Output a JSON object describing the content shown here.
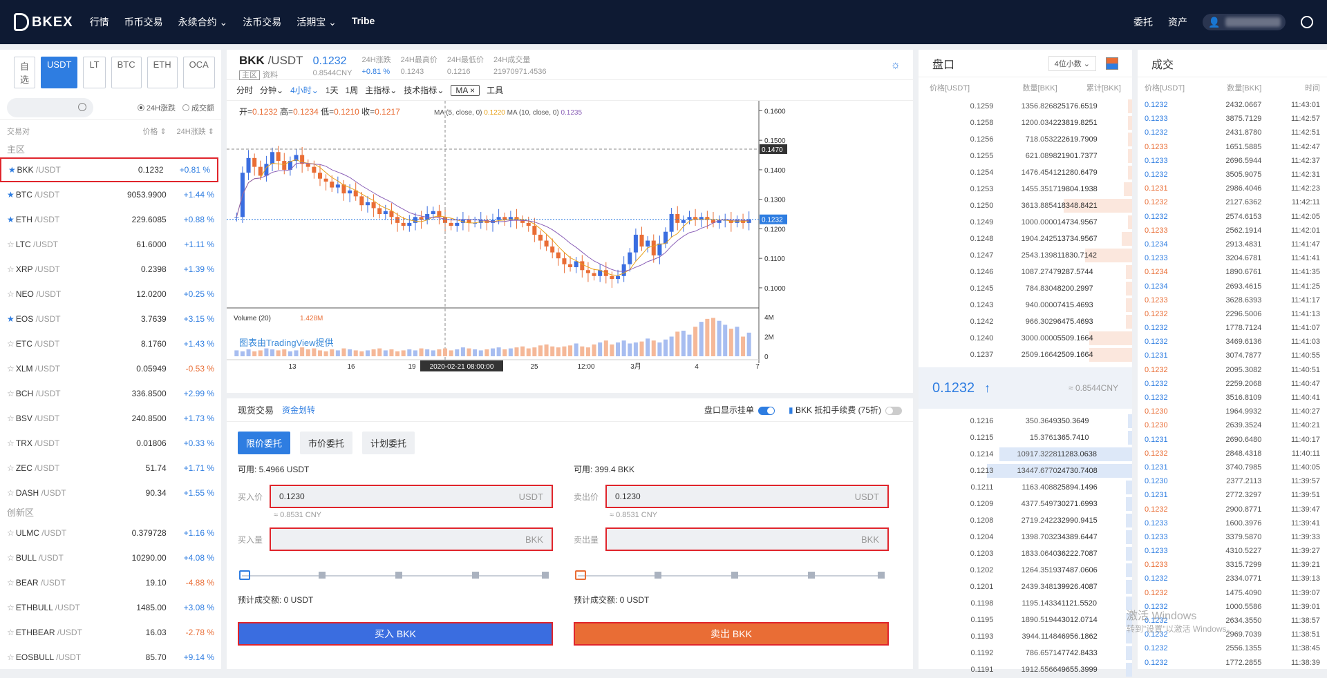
{
  "nav": {
    "brand": "BKEX",
    "items": [
      "行情",
      "币币交易",
      "永续合约",
      "法币交易",
      "活期宝",
      "Tribe"
    ],
    "right": [
      "委托",
      "资产"
    ]
  },
  "markets": {
    "tabs": [
      "自选",
      "USDT",
      "LT",
      "BTC",
      "ETH",
      "OCA"
    ],
    "radio": [
      "24H涨跌",
      "成交额"
    ],
    "head": {
      "pair": "交易对",
      "price": "价格",
      "change": "24H涨跌"
    },
    "sections": [
      "主区",
      "创新区"
    ],
    "main": [
      {
        "base": "BKK",
        "quote": "/USDT",
        "price": "0.1232",
        "change": "+0.81 %",
        "fav": true
      },
      {
        "base": "BTC",
        "quote": "/USDT",
        "price": "9053.9900",
        "change": "+1.44 %",
        "fav": true
      },
      {
        "base": "ETH",
        "quote": "/USDT",
        "price": "229.6085",
        "change": "+0.88 %",
        "fav": true
      },
      {
        "base": "LTC",
        "quote": "/USDT",
        "price": "61.6000",
        "change": "+1.11 %",
        "fav": false
      },
      {
        "base": "XRP",
        "quote": "/USDT",
        "price": "0.2398",
        "change": "+1.39 %",
        "fav": false
      },
      {
        "base": "NEO",
        "quote": "/USDT",
        "price": "12.0200",
        "change": "+0.25 %",
        "fav": false
      },
      {
        "base": "EOS",
        "quote": "/USDT",
        "price": "3.7639",
        "change": "+3.15 %",
        "fav": true
      },
      {
        "base": "ETC",
        "quote": "/USDT",
        "price": "8.1760",
        "change": "+1.43 %",
        "fav": false
      },
      {
        "base": "XLM",
        "quote": "/USDT",
        "price": "0.05949",
        "change": "-0.53 %",
        "fav": false
      },
      {
        "base": "BCH",
        "quote": "/USDT",
        "price": "336.8500",
        "change": "+2.99 %",
        "fav": false
      },
      {
        "base": "BSV",
        "quote": "/USDT",
        "price": "240.8500",
        "change": "+1.73 %",
        "fav": false
      },
      {
        "base": "TRX",
        "quote": "/USDT",
        "price": "0.01806",
        "change": "+0.33 %",
        "fav": false
      },
      {
        "base": "ZEC",
        "quote": "/USDT",
        "price": "51.74",
        "change": "+1.71 %",
        "fav": false
      },
      {
        "base": "DASH",
        "quote": "/USDT",
        "price": "90.34",
        "change": "+1.55 %",
        "fav": false
      }
    ],
    "innovation": [
      {
        "base": "ULMC",
        "quote": "/USDT",
        "price": "0.379728",
        "change": "+1.16 %"
      },
      {
        "base": "BULL",
        "quote": "/USDT",
        "price": "10290.00",
        "change": "+4.08 %"
      },
      {
        "base": "BEAR",
        "quote": "/USDT",
        "price": "19.10",
        "change": "-4.88 %"
      },
      {
        "base": "ETHBULL",
        "quote": "/USDT",
        "price": "1485.00",
        "change": "+3.08 %"
      },
      {
        "base": "ETHBEAR",
        "quote": "/USDT",
        "price": "16.03",
        "change": "-2.78 %"
      },
      {
        "base": "EOSBULL",
        "quote": "/USDT",
        "price": "85.70",
        "change": "+9.14 %"
      }
    ]
  },
  "ticker": {
    "base": "BKK",
    "quote": " /USDT",
    "price": "0.1232",
    "cny": "0.8544CNY",
    "tag": "主区",
    "info": "资料",
    "stats": [
      {
        "l": "24H涨跌",
        "v": "+0.81 %"
      },
      {
        "l": "24H最高价",
        "v": "0.1243"
      },
      {
        "l": "24H最低价",
        "v": "0.1216"
      },
      {
        "l": "24H成交量",
        "v": "21970971.4536"
      }
    ]
  },
  "toolbar": [
    "分时",
    "分钟",
    "4小时",
    "1天",
    "1周",
    "主指标",
    "技术指标",
    "MA",
    "工具"
  ],
  "chart_data": {
    "type": "candlestick",
    "ohlc_legend": {
      "open": "0.1232",
      "high": "0.1234",
      "low": "0.1210",
      "close": "0.1217"
    },
    "ma_labels": [
      "MA (5, close, 0)",
      "0.1220",
      "MA (10, close, 0)",
      "0.1235"
    ],
    "yticks": [
      "0.1600",
      "0.1500",
      "0.1400",
      "0.1300",
      "0.1200",
      "0.1100",
      "0.1000"
    ],
    "ylim": [
      0.096,
      0.1615
    ],
    "current_price": "0.1232",
    "crosshair_price": "0.1470",
    "xticks": [
      "13",
      "16",
      "19",
      "2020-02-21 08:00:00",
      "25",
      "12:00",
      "3月",
      "4",
      "7"
    ],
    "volume_label": "Volume (20)",
    "volume_value": "1.428M",
    "volume_ticks": [
      "4M",
      "2M",
      "0"
    ],
    "attribution": "图表由TradingView提供",
    "close_series": [
      0.124,
      0.139,
      0.144,
      0.141,
      0.138,
      0.142,
      0.146,
      0.143,
      0.14,
      0.143,
      0.145,
      0.142,
      0.141,
      0.139,
      0.137,
      0.136,
      0.134,
      0.135,
      0.132,
      0.133,
      0.131,
      0.128,
      0.129,
      0.127,
      0.125,
      0.126,
      0.124,
      0.122,
      0.121,
      0.122,
      0.124,
      0.123,
      0.125,
      0.126,
      0.124,
      0.122,
      0.121,
      0.122,
      0.123,
      0.122,
      0.122,
      0.123,
      0.122,
      0.123,
      0.124,
      0.123,
      0.124,
      0.123,
      0.122,
      0.121,
      0.118,
      0.116,
      0.114,
      0.112,
      0.11,
      0.108,
      0.107,
      0.109,
      0.106,
      0.105,
      0.104,
      0.106,
      0.104,
      0.103,
      0.104,
      0.108,
      0.112,
      0.118,
      0.114,
      0.116,
      0.111,
      0.115,
      0.119,
      0.125,
      0.122,
      0.123,
      0.124,
      0.123,
      0.124,
      0.123,
      0.122,
      0.123,
      0.123,
      0.122,
      0.123,
      0.122,
      0.1232
    ],
    "volume_series": [
      0.6,
      0.5,
      0.7,
      0.5,
      0.6,
      0.8,
      0.7,
      0.6,
      0.7,
      0.5,
      0.6,
      0.9,
      0.7,
      0.8,
      0.6,
      0.5,
      0.7,
      0.6,
      0.8,
      0.7,
      0.6,
      0.5,
      0.6,
      0.7,
      0.8,
      0.6,
      0.7,
      0.5,
      0.6,
      0.7,
      0.6,
      0.8,
      0.7,
      0.6,
      0.7,
      0.8,
      0.6,
      0.7,
      0.9,
      0.8,
      0.7,
      0.6,
      0.7,
      0.8,
      0.9,
      0.7,
      0.8,
      0.9,
      1.0,
      0.8,
      0.9,
      1.1,
      1.2,
      1.0,
      0.9,
      1.0,
      1.1,
      1.3,
      1.0,
      0.9,
      1.2,
      1.4,
      1.6,
      1.2,
      1.4,
      1.6,
      1.3,
      1.4,
      1.5,
      1.8,
      1.6,
      1.4,
      1.7,
      2.0,
      2.5,
      2.6,
      2.2,
      3.0,
      3.5,
      3.8,
      3.9,
      3.6,
      3.2,
      2.8,
      3.0,
      2.0,
      2.4
    ]
  },
  "order": {
    "title": "现货交易",
    "transfer": "资金划转",
    "depth_toggle": "盘口显示挂单",
    "fee_toggle": "BKK 抵扣手续费 (75折)",
    "tabs": [
      "限价委托",
      "市价委托",
      "计划委托"
    ],
    "buy": {
      "avail": "可用: 5.4966  USDT",
      "price_label": "买入价",
      "price": "0.1230",
      "price_unit": "USDT",
      "cny": "≈ 0.8531 CNY",
      "amount_label": "买入量",
      "amount_unit": "BKK",
      "est": "预计成交额:   0 USDT",
      "btn": "买入 BKK"
    },
    "sell": {
      "avail": "可用: 399.4  BKK",
      "price_label": "卖出价",
      "price": "0.1230",
      "price_unit": "USDT",
      "cny": "≈ 0.8531 CNY",
      "amount_label": "卖出量",
      "amount_unit": "BKK",
      "est": "预计成交额:   0 USDT",
      "btn": "卖出 BKK"
    }
  },
  "book": {
    "title": "盘口",
    "decimals": "4位小数",
    "head": [
      "价格[USDT]",
      "数量[BKK]",
      "累计[BKK]"
    ],
    "asks": [
      [
        "0.1259",
        "1356.8268",
        "25176.6519",
        0.0
      ],
      [
        "0.1258",
        "1200.0342",
        "23819.8251",
        0.0
      ],
      [
        "0.1256",
        "718.0532",
        "22619.7909",
        0.0
      ],
      [
        "0.1255",
        "621.0898",
        "21901.7377",
        0.0
      ],
      [
        "0.1254",
        "1476.4541",
        "21280.6479",
        0.02
      ],
      [
        "0.1253",
        "1455.3517",
        "19804.1938",
        0.04
      ],
      [
        "0.1250",
        "3613.8854",
        "18348.8421",
        0.32
      ],
      [
        "0.1249",
        "1000.0000",
        "14734.9567",
        0.02
      ],
      [
        "0.1248",
        "1904.2425",
        "13734.9567",
        0.05
      ],
      [
        "0.1247",
        "2543.1398",
        "11830.7142",
        0.22
      ],
      [
        "0.1246",
        "1087.2747",
        "9287.5744",
        0.03
      ],
      [
        "0.1245",
        "784.8304",
        "8200.2997",
        0.03
      ],
      [
        "0.1243",
        "940.0000",
        "7415.4693",
        0.03
      ],
      [
        "0.1242",
        "966.3029",
        "6475.4693",
        0.03
      ],
      [
        "0.1240",
        "3000.0000",
        "5509.1664",
        0.2
      ],
      [
        "0.1237",
        "2509.1664",
        "2509.1664",
        0.2
      ]
    ],
    "last": "0.1232",
    "last_cny": "≈ 0.8544CNY",
    "bids": [
      [
        "0.1216",
        "350.3649",
        "350.3649",
        0.0
      ],
      [
        "0.1215",
        "15.3761",
        "365.7410",
        0.0
      ],
      [
        "0.1214",
        "10917.3228",
        "11283.0638",
        0.62
      ],
      [
        "0.1213",
        "13447.6770",
        "24730.7408",
        0.68
      ],
      [
        "0.1211",
        "1163.4088",
        "25894.1496",
        0.03
      ],
      [
        "0.1209",
        "4377.5497",
        "30271.6993",
        0.03
      ],
      [
        "0.1208",
        "2719.2422",
        "32990.9415",
        0.03
      ],
      [
        "0.1204",
        "1398.7032",
        "34389.6447",
        0.03
      ],
      [
        "0.1203",
        "1833.0640",
        "36222.7087",
        0.03
      ],
      [
        "0.1202",
        "1264.3519",
        "37487.0606",
        0.03
      ],
      [
        "0.1201",
        "2439.3481",
        "39926.4087",
        0.03
      ],
      [
        "0.1198",
        "1195.1433",
        "41121.5520",
        0.03
      ],
      [
        "0.1195",
        "1890.5194",
        "43012.0714",
        0.03
      ],
      [
        "0.1193",
        "3944.1148",
        "46956.1862",
        0.03
      ],
      [
        "0.1192",
        "786.6571",
        "47742.8433",
        0.03
      ],
      [
        "0.1191",
        "1912.5566",
        "49655.3999",
        0.03
      ]
    ]
  },
  "trades": {
    "title": "成交",
    "head": [
      "价格[USDT]",
      "数量[BKK]",
      "时间"
    ],
    "rows": [
      [
        "0.1232",
        "2432.0667",
        "11:43:01",
        "up"
      ],
      [
        "0.1233",
        "3875.7129",
        "11:42:57",
        "up"
      ],
      [
        "0.1232",
        "2431.8780",
        "11:42:51",
        "up"
      ],
      [
        "0.1233",
        "1651.5885",
        "11:42:47",
        "dn"
      ],
      [
        "0.1233",
        "2696.5944",
        "11:42:37",
        "up"
      ],
      [
        "0.1232",
        "3505.9075",
        "11:42:31",
        "up"
      ],
      [
        "0.1231",
        "2986.4046",
        "11:42:23",
        "dn"
      ],
      [
        "0.1232",
        "2127.6362",
        "11:42:11",
        "dn"
      ],
      [
        "0.1232",
        "2574.6153",
        "11:42:05",
        "up"
      ],
      [
        "0.1233",
        "2562.1914",
        "11:42:01",
        "dn"
      ],
      [
        "0.1234",
        "2913.4831",
        "11:41:47",
        "up"
      ],
      [
        "0.1233",
        "3204.6781",
        "11:41:41",
        "up"
      ],
      [
        "0.1234",
        "1890.6761",
        "11:41:35",
        "dn"
      ],
      [
        "0.1234",
        "2693.4615",
        "11:41:25",
        "up"
      ],
      [
        "0.1233",
        "3628.6393",
        "11:41:17",
        "dn"
      ],
      [
        "0.1232",
        "2296.5006",
        "11:41:13",
        "dn"
      ],
      [
        "0.1232",
        "1778.7124",
        "11:41:07",
        "up"
      ],
      [
        "0.1232",
        "3469.6136",
        "11:41:03",
        "up"
      ],
      [
        "0.1231",
        "3074.7877",
        "11:40:55",
        "up"
      ],
      [
        "0.1232",
        "2095.3082",
        "11:40:51",
        "dn"
      ],
      [
        "0.1232",
        "2259.2068",
        "11:40:47",
        "up"
      ],
      [
        "0.1232",
        "3516.8109",
        "11:40:41",
        "up"
      ],
      [
        "0.1230",
        "1964.9932",
        "11:40:27",
        "dn"
      ],
      [
        "0.1230",
        "2639.3524",
        "11:40:21",
        "dn"
      ],
      [
        "0.1231",
        "2690.6480",
        "11:40:17",
        "up"
      ],
      [
        "0.1232",
        "2848.4318",
        "11:40:11",
        "dn"
      ],
      [
        "0.1231",
        "3740.7985",
        "11:40:05",
        "up"
      ],
      [
        "0.1230",
        "2377.2113",
        "11:39:57",
        "up"
      ],
      [
        "0.1231",
        "2772.3297",
        "11:39:51",
        "up"
      ],
      [
        "0.1232",
        "2900.8771",
        "11:39:47",
        "dn"
      ],
      [
        "0.1233",
        "1600.3976",
        "11:39:41",
        "up"
      ],
      [
        "0.1233",
        "3379.5870",
        "11:39:33",
        "up"
      ],
      [
        "0.1233",
        "4310.5227",
        "11:39:27",
        "up"
      ],
      [
        "0.1233",
        "3315.7299",
        "11:39:21",
        "dn"
      ],
      [
        "0.1232",
        "2334.0771",
        "11:39:13",
        "up"
      ],
      [
        "0.1232",
        "1475.4090",
        "11:39:07",
        "dn"
      ],
      [
        "0.1232",
        "1000.5586",
        "11:39:01",
        "up"
      ],
      [
        "0.1232",
        "2634.3550",
        "11:38:57",
        "up"
      ],
      [
        "0.1232",
        "2969.7039",
        "11:38:51",
        "up"
      ],
      [
        "0.1232",
        "2556.1355",
        "11:38:45",
        "up"
      ],
      [
        "0.1232",
        "1772.2855",
        "11:38:39",
        "up"
      ]
    ]
  },
  "watermark": {
    "line1": "激活 Windows",
    "line2": "转到\"设置\"以激活 Windows。"
  }
}
